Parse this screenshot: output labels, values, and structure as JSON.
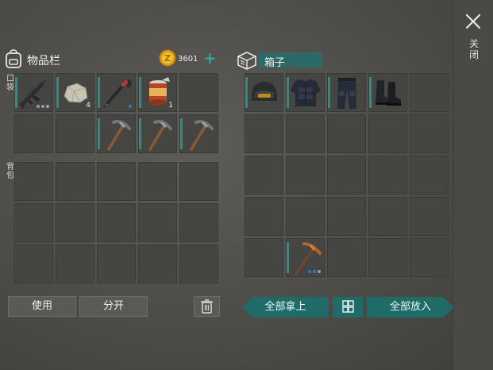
{
  "header": {
    "close_label": "关闭"
  },
  "inventory": {
    "title": "物品栏",
    "coins": "3601",
    "pocket_label": "口袋",
    "backpack_label": "背包",
    "pocket_slots": [
      {
        "item": "assault-rifle",
        "qty": "",
        "dots": [
          "#9a9aa6",
          "#9a9aa6",
          "#b58fc6"
        ]
      },
      {
        "item": "stone",
        "qty": "4",
        "dots": []
      },
      {
        "item": "crowbar",
        "qty": "",
        "dots": [
          "#2e78c9"
        ]
      },
      {
        "item": "canned-food",
        "qty": "1",
        "dots": []
      },
      {
        "item": "",
        "qty": "",
        "dots": []
      },
      {
        "item": "",
        "qty": "",
        "dots": []
      },
      {
        "item": "",
        "qty": "",
        "dots": []
      },
      {
        "item": "pickaxe",
        "qty": "",
        "dots": []
      },
      {
        "item": "pickaxe",
        "qty": "",
        "dots": []
      },
      {
        "item": "pickaxe",
        "qty": "",
        "dots": []
      }
    ],
    "backpack_slots": 15,
    "use_label": "使用",
    "split_label": "分开"
  },
  "box": {
    "title": "箱子",
    "slots": [
      {
        "item": "helmet",
        "dots": []
      },
      {
        "item": "body-armor",
        "dots": []
      },
      {
        "item": "armored-pants",
        "dots": []
      },
      {
        "item": "boots",
        "dots": []
      },
      {
        "item": "",
        "dots": []
      },
      {
        "item": "",
        "dots": []
      },
      {
        "item": "",
        "dots": []
      },
      {
        "item": "",
        "dots": []
      },
      {
        "item": "",
        "dots": []
      },
      {
        "item": "",
        "dots": []
      },
      {
        "item": "",
        "dots": []
      },
      {
        "item": "",
        "dots": []
      },
      {
        "item": "",
        "dots": []
      },
      {
        "item": "",
        "dots": []
      },
      {
        "item": "",
        "dots": []
      },
      {
        "item": "",
        "dots": []
      },
      {
        "item": "",
        "dots": []
      },
      {
        "item": "",
        "dots": []
      },
      {
        "item": "",
        "dots": []
      },
      {
        "item": "",
        "dots": []
      },
      {
        "item": "",
        "dots": []
      },
      {
        "item": "copper-pickaxe",
        "dots": [
          "#2e78c9",
          "#2e78c9",
          "#9a9aa6"
        ]
      },
      {
        "item": "",
        "dots": []
      },
      {
        "item": "",
        "dots": []
      },
      {
        "item": "",
        "dots": []
      }
    ],
    "take_all_label": "全部拿上",
    "put_all_label": "全部放入"
  },
  "colors": {
    "accent": "#2a8f86",
    "button_teal": "#1f6b68",
    "coin": "#e0a81e"
  }
}
